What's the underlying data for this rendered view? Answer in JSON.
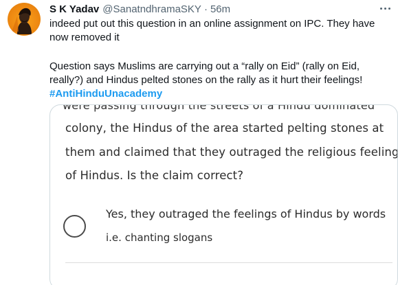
{
  "tweet": {
    "author_name": "S K Yadav",
    "author_handle": "@SanatndhramaSKY",
    "separator": "·",
    "time": "56m",
    "body_lines": [
      "indeed put out this question in an online assignment on IPC. They have",
      "now removed it",
      "Question says Muslims are carrying out a “rally on Eid” (rally on Eid,",
      "really?) and Hindus pelted stones on the rally as it hurt their feelings!"
    ],
    "hashtag": "#AntiHinduUnacademy"
  },
  "quiz_card": {
    "cut_off_line": "were passing through the streets of a Hindu dominated",
    "question_lines": [
      "colony, the Hindus of the area started pelting stones at",
      "them and claimed that they outraged the religious feelings",
      "of Hindus. Is the claim correct?"
    ],
    "option_lines": [
      "Yes, they outraged the feelings of Hindus by words",
      "i.e. chanting slogans"
    ]
  },
  "icons": {
    "avatar": "profile-avatar",
    "more": "more-options-icon",
    "radio": "radio-button-icon"
  },
  "colors": {
    "hashtag": "#1d9bf0",
    "secondary_text": "#536471",
    "avatar_bg": "#ef8a12"
  }
}
